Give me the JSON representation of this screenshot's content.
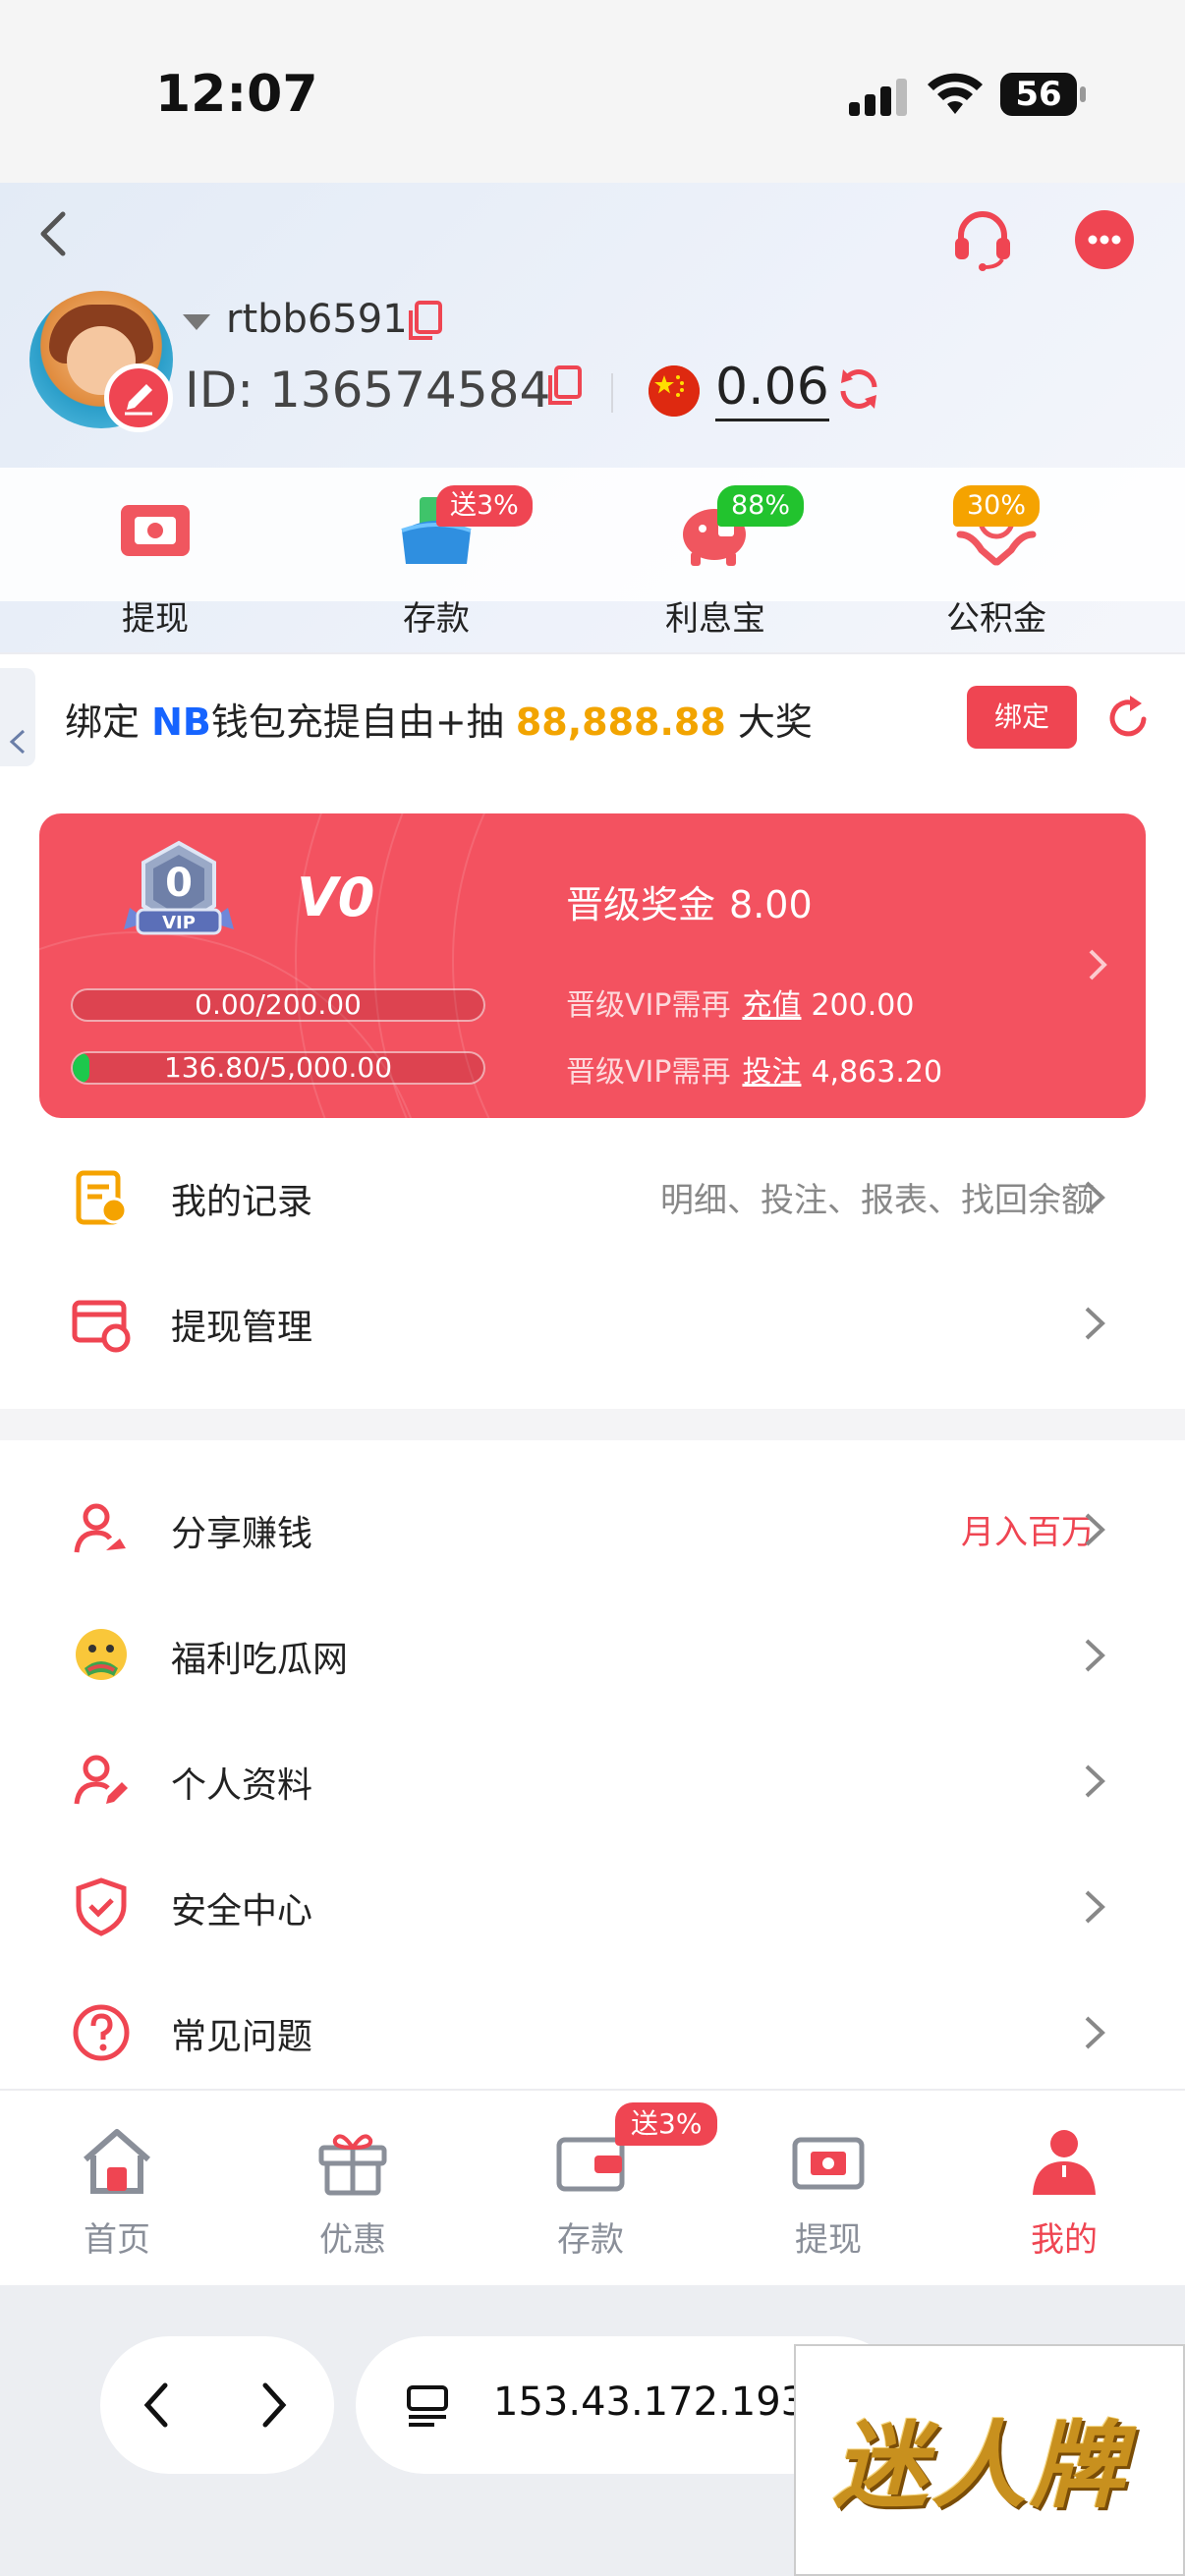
{
  "status": {
    "time": "12:07",
    "battery": "56"
  },
  "user": {
    "username": "rtbb6591",
    "id_label": "ID: 136574584",
    "balance": "0.06"
  },
  "quick_actions": [
    {
      "label": "提现",
      "icon": "withdraw-icon"
    },
    {
      "label": "存款",
      "icon": "deposit-wallet-icon",
      "badge": "送3%"
    },
    {
      "label": "利息宝",
      "icon": "piggy-bank-icon",
      "badge": "88%"
    },
    {
      "label": "公积金",
      "icon": "fund-hands-icon",
      "badge": "30%"
    }
  ],
  "bind_banner": {
    "prefix": "绑定",
    "brand": "NB",
    "middle": "钱包充提自由+抽",
    "amount": "88,888.88",
    "suffix": "大奖",
    "button": "绑定"
  },
  "vip": {
    "medal": "0",
    "medal_tag": "VIP",
    "level": "V0",
    "bonus_label": "晋级奖金",
    "bonus_value": "8.00",
    "recharge_need": {
      "prefix": "晋级VIP需再",
      "link": "充值",
      "value": "200.00"
    },
    "bet_need": {
      "prefix": "晋级VIP需再",
      "link": "投注",
      "value": "4,863.20"
    },
    "recharge_progress": {
      "text": "0.00/200.00",
      "fraction": 0.0
    },
    "bet_progress": {
      "text": "136.80/5,000.00",
      "fraction": 0.027
    }
  },
  "menu_group1": [
    {
      "label": "我的记录",
      "right": "明细、投注、报表、找回余额",
      "icon": "records-icon"
    },
    {
      "label": "提现管理",
      "right": "",
      "icon": "withdraw-manage-icon"
    }
  ],
  "menu_group2": [
    {
      "label": "分享赚钱",
      "right": "月入百万",
      "icon": "share-earn-icon"
    },
    {
      "label": "福利吃瓜网",
      "right": "",
      "icon": "melon-emoji-icon"
    },
    {
      "label": "个人资料",
      "right": "",
      "icon": "profile-edit-icon"
    },
    {
      "label": "安全中心",
      "right": "",
      "icon": "shield-check-icon"
    },
    {
      "label": "常见问题",
      "right": "",
      "icon": "question-icon"
    }
  ],
  "tabbar": [
    {
      "label": "首页",
      "icon": "home-icon"
    },
    {
      "label": "优惠",
      "icon": "gift-icon"
    },
    {
      "label": "存款",
      "icon": "wallet-icon",
      "badge": "送3%"
    },
    {
      "label": "提现",
      "icon": "withdraw-ticket-icon"
    },
    {
      "label": "我的",
      "icon": "person-icon",
      "active": true
    }
  ],
  "browser": {
    "url": "153.43.172.193"
  },
  "ad": {
    "text": "迷人牌"
  },
  "colors": {
    "accent": "#ef4552",
    "vip_card": "#f35260",
    "gold": "#f2a400",
    "green": "#1dc84c"
  }
}
